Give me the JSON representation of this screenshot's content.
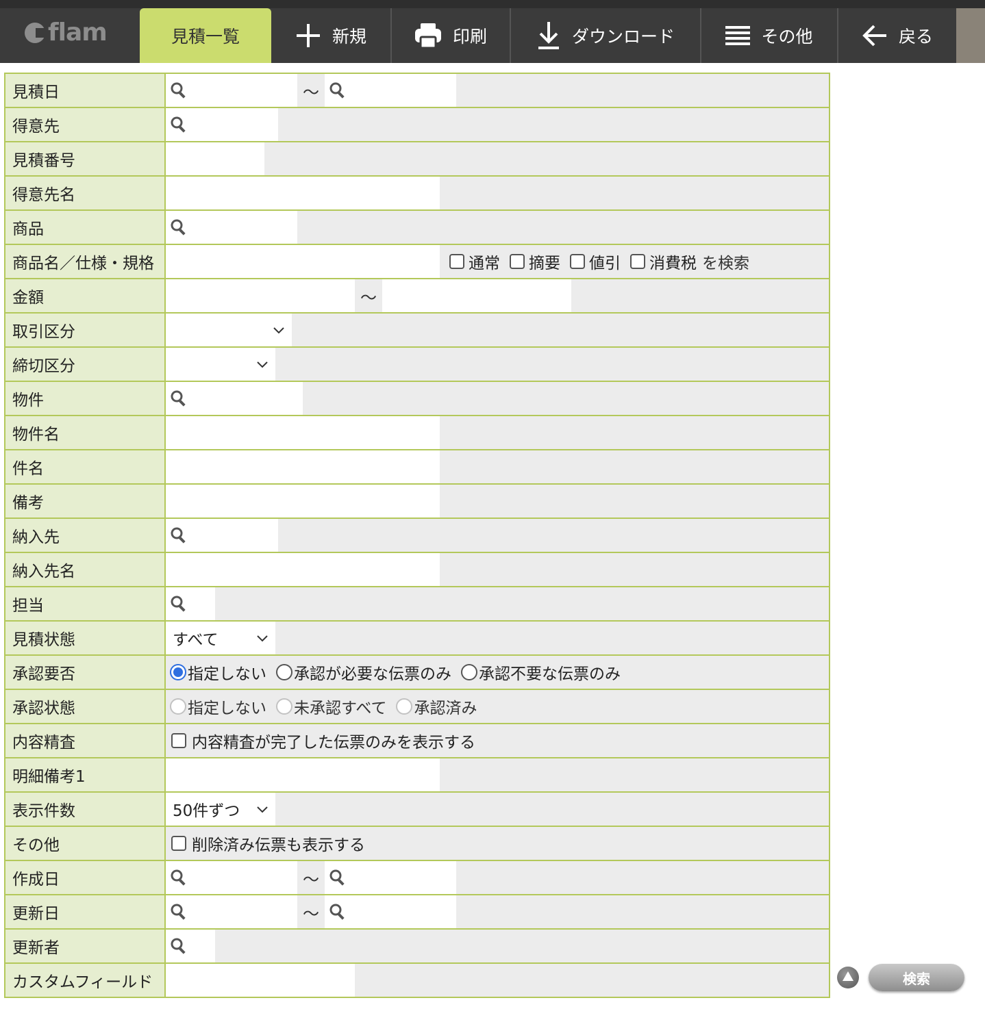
{
  "logo": {
    "text": "flam"
  },
  "nav": {
    "list": "見積一覧",
    "new": "新規",
    "print": "印刷",
    "download": "ダウンロード",
    "other": "その他",
    "back": "戻る"
  },
  "fields": {
    "quote_date": "見積日",
    "customer": "得意先",
    "quote_no": "見積番号",
    "customer_name": "得意先名",
    "product": "商品",
    "product_name": "商品名／仕様・規格",
    "amount": "金額",
    "trade_type": "取引区分",
    "closing_type": "締切区分",
    "property": "物件",
    "property_name": "物件名",
    "subject": "件名",
    "remarks": "備考",
    "delivery": "納入先",
    "delivery_name": "納入先名",
    "staff": "担当",
    "quote_status": "見積状態",
    "approval_required": "承認要否",
    "approval_status": "承認状態",
    "content_check": "内容精査",
    "detail_remarks1": "明細備考1",
    "display_count": "表示件数",
    "others": "その他",
    "created_date": "作成日",
    "updated_date": "更新日",
    "updated_by": "更新者",
    "custom_field": "カスタムフィールド"
  },
  "tilde": "～",
  "product_name_options": {
    "normal": "通常",
    "summary": "摘要",
    "discount": "値引",
    "tax": "消費税",
    "suffix": "を検索"
  },
  "quote_status_value": "すべて",
  "approval_required_options": [
    "指定しない",
    "承認が必要な伝票のみ",
    "承認不要な伝票のみ"
  ],
  "approval_status_options": [
    "指定しない",
    "未承認すべて",
    "承認済み"
  ],
  "content_check_text": "内容精査が完了した伝票のみを表示する",
  "display_count_value": "50件ずつ",
  "others_text": "削除済み伝票も表示する",
  "search_button": "検索",
  "colors": {
    "active_tab": "#cbdc6e",
    "label_bg": "#e6eed0",
    "border": "#b3c85a",
    "radio_on": "#2f6fe0"
  }
}
